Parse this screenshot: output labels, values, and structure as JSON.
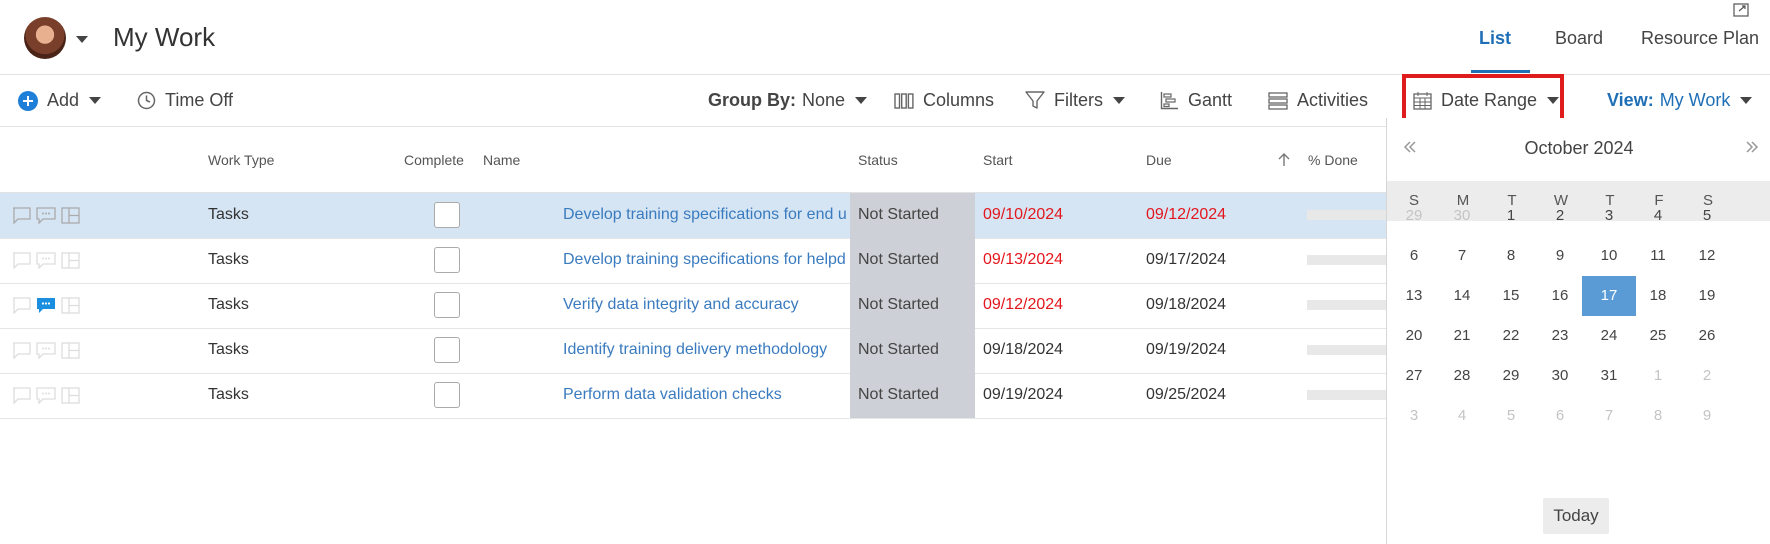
{
  "header": {
    "title": "My Work",
    "tabs": {
      "list": "List",
      "board": "Board",
      "resource_plan": "Resource Plan"
    },
    "active_tab": "List"
  },
  "toolbar": {
    "add": "Add",
    "time_off": "Time Off",
    "group_by_label": "Group By:",
    "group_by_value": "None",
    "columns": "Columns",
    "filters": "Filters",
    "gantt": "Gantt",
    "activities": "Activities",
    "date_range": "Date Range",
    "view_label": "View:",
    "view_value": "My Work"
  },
  "grid": {
    "columns": {
      "work_type": "Work Type",
      "complete": "Complete",
      "name": "Name",
      "status": "Status",
      "start": "Start",
      "due": "Due",
      "pct_done": "% Done"
    },
    "rows": [
      {
        "work_type": "Tasks",
        "name": "Develop training specifications for end u",
        "status": "Not Started",
        "start": "09/10/2024",
        "due": "09/12/2024"
      },
      {
        "work_type": "Tasks",
        "name": "Develop training specifications for helpd",
        "status": "Not Started",
        "start": "09/13/2024",
        "due": "09/17/2024"
      },
      {
        "work_type": "Tasks",
        "name": "Verify data integrity and accuracy",
        "status": "Not Started",
        "start": "09/12/2024",
        "due": "09/18/2024"
      },
      {
        "work_type": "Tasks",
        "name": "Identify training delivery methodology",
        "status": "Not Started",
        "start": "09/18/2024",
        "due": "09/19/2024"
      },
      {
        "work_type": "Tasks",
        "name": "Perform data validation checks",
        "status": "Not Started",
        "start": "09/19/2024",
        "due": "09/25/2024"
      }
    ]
  },
  "calendar": {
    "month_title": "October 2024",
    "weekdays": [
      "S",
      "M",
      "T",
      "W",
      "T",
      "F",
      "S"
    ],
    "weeks": [
      [
        "29",
        "30",
        "1",
        "2",
        "3",
        "4",
        "5"
      ],
      [
        "6",
        "7",
        "8",
        "9",
        "10",
        "11",
        "12"
      ],
      [
        "13",
        "14",
        "15",
        "16",
        "17",
        "18",
        "19"
      ],
      [
        "20",
        "21",
        "22",
        "23",
        "24",
        "25",
        "26"
      ],
      [
        "27",
        "28",
        "29",
        "30",
        "31",
        "1",
        "2"
      ],
      [
        "3",
        "4",
        "5",
        "6",
        "7",
        "8",
        "9"
      ]
    ],
    "selected_day": "17",
    "today_label": "Today"
  },
  "colors": {
    "accent": "#1f6fb7",
    "link": "#3a7bbf",
    "late": "#e4161d",
    "selected_row": "#d5e5f3",
    "status_bg": "#cdd0d6",
    "calendar_selected": "#5b9bd5",
    "highlight_box": "#e01b1b"
  }
}
